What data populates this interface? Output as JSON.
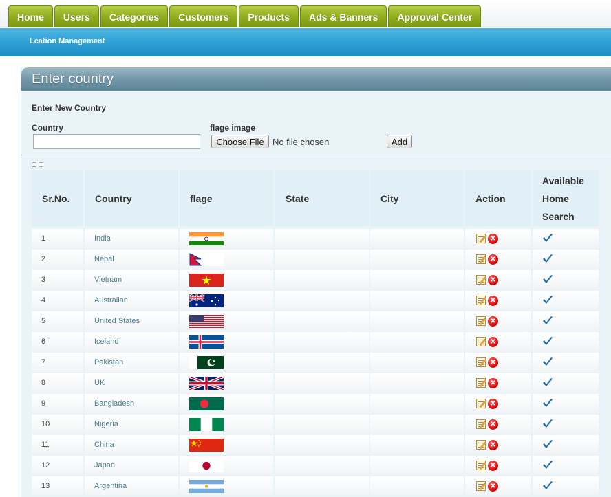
{
  "nav": {
    "tabs": [
      "Home",
      "Users",
      "Categories",
      "Customers",
      "Products",
      "Ads & Banners",
      "Approval Center"
    ],
    "sub_link": "Lcation Management"
  },
  "panel": {
    "title": "Enter country",
    "section_label": "Enter New Country",
    "country_label": "Country",
    "country_value": "",
    "flag_label": "flage image",
    "choose_file": "Choose File",
    "file_status": "No file chosen",
    "add_button": "Add"
  },
  "table": {
    "headers": {
      "srno": "Sr.No.",
      "country": "Country",
      "flag": "flage",
      "state": "State",
      "city": "City",
      "action": "Action",
      "available_1": "Available",
      "available_2": "Home",
      "available_3": "Search"
    },
    "rows": [
      {
        "sr": "1",
        "country": "India",
        "flag": "india-flag"
      },
      {
        "sr": "2",
        "country": "Nepal",
        "flag": "nepal-flag"
      },
      {
        "sr": "3",
        "country": "Vietnam",
        "flag": "vietnam-flag"
      },
      {
        "sr": "4",
        "country": "Australian",
        "flag": "australia-flag"
      },
      {
        "sr": "5",
        "country": "United States",
        "flag": "usa-flag"
      },
      {
        "sr": "6",
        "country": "Iceland",
        "flag": "iceland-flag"
      },
      {
        "sr": "7",
        "country": "Pakistan",
        "flag": "pakistan-flag"
      },
      {
        "sr": "8",
        "country": "UK",
        "flag": "uk-flag"
      },
      {
        "sr": "9",
        "country": "Bangladesh",
        "flag": "bangladesh-flag"
      },
      {
        "sr": "10",
        "country": "Nigeria",
        "flag": "nigeria-flag"
      },
      {
        "sr": "11",
        "country": "China",
        "flag": "china-flag"
      },
      {
        "sr": "12",
        "country": "Japan",
        "flag": "japan-flag"
      },
      {
        "sr": "13",
        "country": "Argentina",
        "flag": "argentina-flag"
      }
    ]
  },
  "colors": {
    "tab_green": "#8eab1d",
    "subbar_blue": "#2a9dd2",
    "panel_bg": "#e9f3f8",
    "link_teal": "#4e7e8c",
    "check_blue": "#1f6fb3"
  }
}
